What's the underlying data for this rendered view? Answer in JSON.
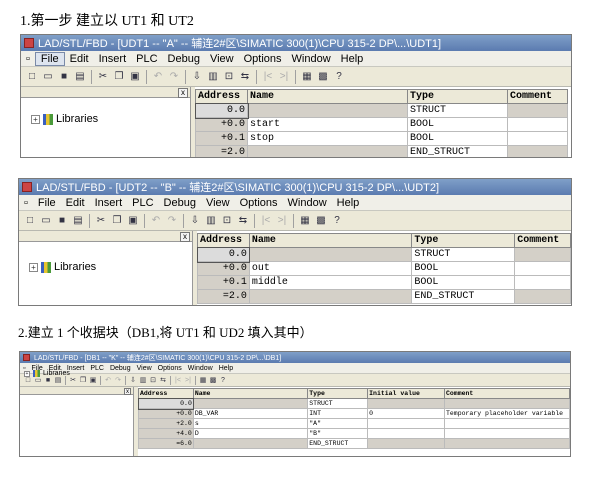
{
  "captions": {
    "step1": "1.第一步 建立以 UT1 和 UT2",
    "step2": "2.建立 1 个收据块（DB1,将 UT1 和 UD2 填入其中）"
  },
  "menu": [
    "File",
    "Edit",
    "Insert",
    "PLC",
    "Debug",
    "View",
    "Options",
    "Window",
    "Help"
  ],
  "libraries_label": "Libraries",
  "close_glyph": "x",
  "expander_glyph": "+",
  "windows": [
    {
      "title": "LAD/STL/FBD - [UDT1 -- \"A\" -- 辅连2#区\\SIMATIC 300(1)\\CPU 315-2 DP\\...\\UDT1]",
      "headers": [
        "Address",
        "Name",
        "Type",
        "Comment"
      ],
      "rows": [
        {
          "address": "0.0",
          "name": "",
          "type": "STRUCT",
          "comment": ""
        },
        {
          "address": "+0.0",
          "name": "start",
          "type": "BOOL",
          "comment": ""
        },
        {
          "address": "+0.1",
          "name": "stop",
          "type": "BOOL",
          "comment": ""
        },
        {
          "address": "=2.0",
          "name": "",
          "type": "END_STRUCT",
          "comment": ""
        }
      ]
    },
    {
      "title": "LAD/STL/FBD - [UDT2 -- \"B\" -- 辅连2#区\\SIMATIC 300(1)\\CPU 315-2 DP\\...\\UDT2]",
      "headers": [
        "Address",
        "Name",
        "Type",
        "Comment"
      ],
      "rows": [
        {
          "address": "0.0",
          "name": "",
          "type": "STRUCT",
          "comment": ""
        },
        {
          "address": "+0.0",
          "name": "out",
          "type": "BOOL",
          "comment": ""
        },
        {
          "address": "+0.1",
          "name": "middle",
          "type": "BOOL",
          "comment": ""
        },
        {
          "address": "=2.0",
          "name": "",
          "type": "END_STRUCT",
          "comment": ""
        }
      ]
    },
    {
      "title": "LAD/STL/FBD - [DB1 -- \"K\" -- 辅连2#区\\SIMATIC 300(1)\\CPU 315-2 DP\\...\\DB1]",
      "headers": [
        "Address",
        "Name",
        "Type",
        "Initial value",
        "Comment"
      ],
      "rows": [
        {
          "address": "0.0",
          "name": "",
          "type": "STRUCT",
          "initial": "",
          "comment": ""
        },
        {
          "address": "+0.0",
          "name": "DB_VAR",
          "type": "INT",
          "initial": "0",
          "comment": "Temporary placeholder variable"
        },
        {
          "address": "+2.0",
          "name": "s",
          "type": "\"A\"",
          "initial": "",
          "comment": ""
        },
        {
          "address": "+4.0",
          "name": "D",
          "type": "\"B\"",
          "initial": "",
          "comment": ""
        },
        {
          "address": "=6.0",
          "name": "",
          "type": "END_STRUCT",
          "initial": "",
          "comment": ""
        }
      ]
    }
  ],
  "toolbar_icons": [
    {
      "name": "new-icon",
      "glyph": "□"
    },
    {
      "name": "open-icon",
      "glyph": "▭"
    },
    {
      "name": "save-icon",
      "glyph": "■"
    },
    {
      "name": "print-icon",
      "glyph": "▤"
    },
    {
      "name": "cut-icon",
      "glyph": "✂"
    },
    {
      "name": "copy-icon",
      "glyph": "❐"
    },
    {
      "name": "paste-icon",
      "glyph": "▣"
    },
    {
      "name": "undo-icon",
      "glyph": "↶"
    },
    {
      "name": "redo-icon",
      "glyph": "↷"
    },
    {
      "name": "download-icon",
      "glyph": "⇩"
    },
    {
      "name": "monitor-icon",
      "glyph": "▥"
    },
    {
      "name": "compile-icon",
      "glyph": "⊡"
    },
    {
      "name": "goto-icon",
      "glyph": "⇆"
    },
    {
      "name": "nav-first-icon",
      "glyph": "|<"
    },
    {
      "name": "nav-last-icon",
      "glyph": ">|"
    },
    {
      "name": "overview-icon",
      "glyph": "▦"
    },
    {
      "name": "details-icon",
      "glyph": "▩"
    },
    {
      "name": "help-icon",
      "glyph": "?"
    }
  ]
}
